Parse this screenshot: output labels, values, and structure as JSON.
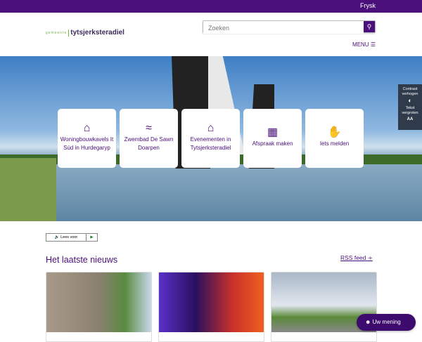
{
  "topbar": {
    "language": "Frysk"
  },
  "logo": {
    "prefix": "gemeente",
    "name": "tytsjerksteradiel"
  },
  "search": {
    "placeholder": "Zoeken",
    "button_icon": "search-icon"
  },
  "menu": {
    "label": "MENU",
    "icon": "hamburger-icon"
  },
  "tiles": [
    {
      "label": "Woningbouwkavels It Súd in Hurdegaryp",
      "icon": "house-icon"
    },
    {
      "label": "Zwembad De Sawn Doarpen",
      "icon": "swimmer-icon"
    },
    {
      "label": "Evenementen in Tytsjerksteradiel",
      "icon": "tent-icon"
    },
    {
      "label": "Afspraak maken",
      "icon": "calendar-clock-icon"
    },
    {
      "label": "Iets melden",
      "icon": "person-raising-hand-icon"
    }
  ],
  "accessibility": {
    "contrast": "Contrast verhogen",
    "text_size": "Tekst vergroten",
    "text_size_glyph": "AA"
  },
  "read_aloud": {
    "label": "Lees voor"
  },
  "news": {
    "title": "Het laatste nieuws",
    "rss": "RSS feed"
  },
  "feedback": {
    "label": "Uw mening"
  },
  "colors": {
    "brand": "#4a0f7a",
    "accent_green": "#7ab648"
  }
}
